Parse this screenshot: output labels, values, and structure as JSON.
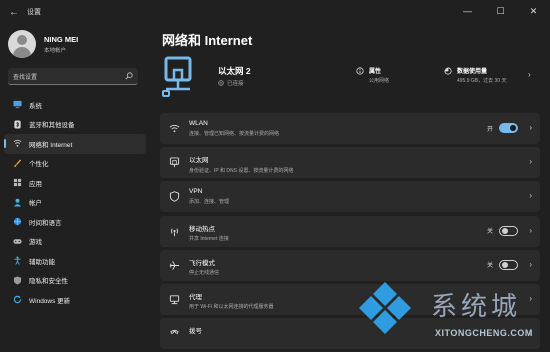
{
  "window": {
    "title": "设置",
    "controls": [
      "—",
      "☐",
      "✕"
    ]
  },
  "user": {
    "name": "NING MEI",
    "sub": "本地帐户"
  },
  "search": {
    "placeholder": "查找设置"
  },
  "nav": [
    {
      "label": "系统",
      "icon": "monitor-icon",
      "active": false
    },
    {
      "label": "蓝牙和其他设备",
      "icon": "bluetooth-icon",
      "active": false
    },
    {
      "label": "网络和 Internet",
      "icon": "network-icon",
      "active": true
    },
    {
      "label": "个性化",
      "icon": "brush-icon",
      "active": false
    },
    {
      "label": "应用",
      "icon": "apps-icon",
      "active": false
    },
    {
      "label": "帐户",
      "icon": "account-icon",
      "active": false
    },
    {
      "label": "时间和语言",
      "icon": "globe-clock-icon",
      "active": false
    },
    {
      "label": "游戏",
      "icon": "gamepad-icon",
      "active": false
    },
    {
      "label": "辅助功能",
      "icon": "accessibility-icon",
      "active": false
    },
    {
      "label": "隐私和安全性",
      "icon": "shield-icon",
      "active": false
    },
    {
      "label": "Windows 更新",
      "icon": "update-icon",
      "active": false
    }
  ],
  "page": {
    "title": "网络和 Internet"
  },
  "connection": {
    "name": "以太网 2",
    "status": "已连接",
    "properties": {
      "title": "属性",
      "sub": "公用网络"
    },
    "usage": {
      "title": "数据使用量",
      "sub": "495.9 GB，过去 30 天"
    }
  },
  "cards": [
    {
      "title": "WLAN",
      "sub": "连接、管理已知网络、按流量计费的网络",
      "icon": "wifi-icon",
      "toggle": {
        "label": "开",
        "on": true
      }
    },
    {
      "title": "以太网",
      "sub": "身份验证、IP 和 DNS 设置、按流量计费的网络",
      "icon": "ethernet-icon"
    },
    {
      "title": "VPN",
      "sub": "添加、连接、管理",
      "icon": "vpn-icon"
    },
    {
      "title": "移动热点",
      "sub": "共享 Internet 连接",
      "icon": "hotspot-icon",
      "toggle": {
        "label": "关",
        "on": false
      }
    },
    {
      "title": "飞行模式",
      "sub": "停止无线通信",
      "icon": "airplane-icon",
      "toggle": {
        "label": "关",
        "on": false
      }
    },
    {
      "title": "代理",
      "sub": "用于 Wi-Fi 和以太网连接的代理服务器",
      "icon": "proxy-icon"
    },
    {
      "title": "拨号",
      "sub": "",
      "icon": "dialup-icon"
    }
  ],
  "watermark": {
    "cn": "系统城",
    "en": "XITONGCHENG.COM"
  },
  "colors": {
    "accent": "#76b9ed",
    "background": "#202020",
    "card": "#2b2b2b"
  }
}
